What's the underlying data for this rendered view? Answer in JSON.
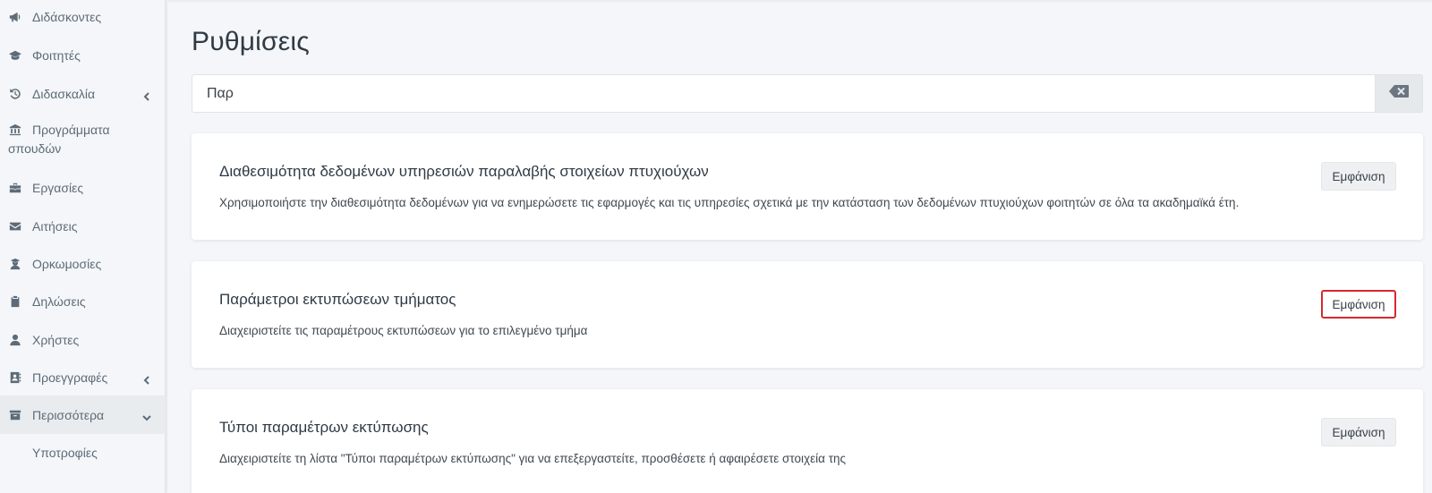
{
  "sidebar": {
    "items": [
      {
        "label": "Διδάσκοντες",
        "icon": "megaphone-icon"
      },
      {
        "label": "Φοιτητές",
        "icon": "graduation-cap-icon"
      },
      {
        "label": "Διδασκαλία",
        "icon": "history-icon",
        "expandable": true
      },
      {
        "label": "Προγράμματα σπουδών",
        "icon": "university-icon"
      },
      {
        "label": "Εργασίες",
        "icon": "briefcase-icon"
      },
      {
        "label": "Αιτήσεις",
        "icon": "envelope-icon"
      },
      {
        "label": "Ορκωμοσίες",
        "icon": "graduate-user-icon"
      },
      {
        "label": "Δηλώσεις",
        "icon": "clipboard-icon"
      },
      {
        "label": "Χρήστες",
        "icon": "user-icon"
      },
      {
        "label": "Προεγγραφές",
        "icon": "address-book-icon",
        "expandable": true
      },
      {
        "label": "Περισσότερα",
        "icon": "archive-icon",
        "expandable": true,
        "expanded": true
      },
      {
        "label": "Υποτροφίες",
        "icon": "",
        "sub": true
      }
    ]
  },
  "page": {
    "title": "Ρυθμίσεις"
  },
  "search": {
    "value": "Παρ",
    "clear_icon": "backspace-icon"
  },
  "cards": [
    {
      "title": "Διαθεσιμότητα δεδομένων υπηρεσιών παραλαβής στοιχείων πτυχιούχων",
      "description": "Χρησιμοποιήστε την διαθεσιμότητα δεδομένων για να ενημερώσετε τις εφαρμογές και τις υπηρεσίες σχετικά με την κατάσταση των δεδομένων πτυχιούχων φοιτητών σε όλα τα ακαδημαϊκά έτη.",
      "button": "Εμφάνιση"
    },
    {
      "title": "Παράμετροι εκτυπώσεων τμήματος",
      "description": "Διαχειριστείτε τις παραμέτρους εκτυπώσεων για το επιλεγμένο τμήμα",
      "button": "Εμφάνιση",
      "highlighted": true
    },
    {
      "title": "Τύποι παραμέτρων εκτύπωσης",
      "description": "Διαχειριστείτε τη λίστα \"Τύποι παραμέτρων εκτύπωσης\" για να επεξεργαστείτε, προσθέσετε ή αφαιρέσετε στοιχεία της",
      "button": "Εμφάνιση"
    }
  ],
  "colors": {
    "highlight_border": "#d42a2f",
    "background": "#f4f6f9"
  }
}
